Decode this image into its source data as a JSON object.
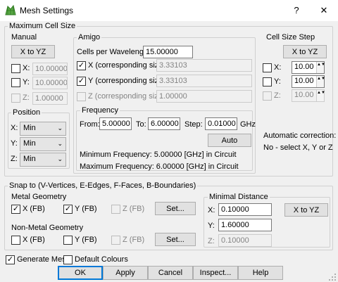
{
  "window": {
    "title": "Mesh Settings",
    "help_icon": "?",
    "close_icon": "✕"
  },
  "max_cell": {
    "group_label": "Maximum Cell Size",
    "manual": {
      "label": "Manual",
      "x_to_yz_label": "X to YZ",
      "x": {
        "label": "X:",
        "checked": false,
        "value": "10.00000",
        "disabled": true
      },
      "y": {
        "label": "Y:",
        "checked": false,
        "value": "10.00000",
        "disabled": true
      },
      "z": {
        "label": "Z:",
        "checked": false,
        "value": "1.00000",
        "disabled": true
      }
    },
    "position": {
      "label": "Position",
      "x": {
        "label": "X:",
        "value": "Min"
      },
      "y": {
        "label": "Y:",
        "value": "Min"
      },
      "z": {
        "label": "Z:",
        "value": "Min"
      }
    },
    "amigo": {
      "label": "Amigo",
      "cells_per_wavelength_label": "Cells per Wavelength:",
      "cells_per_wavelength": "15.00000",
      "x": {
        "label": "X (corresponding size)",
        "checked": true,
        "value": "3.33103"
      },
      "y": {
        "label": "Y (corresponding size)",
        "checked": true,
        "value": "3.33103"
      },
      "z": {
        "label": "Z (corresponding size)",
        "checked": false,
        "value": "1.00000"
      },
      "frequency": {
        "label": "Frequency",
        "from_label": "From:",
        "from": "5.00000",
        "to_label": "To:",
        "to": "6.00000",
        "step_label": "Step:",
        "step": "0.01000",
        "unit": "GHz",
        "auto_label": "Auto",
        "min_text": "Minimum Frequency: 5.00000 [GHz] in Circuit",
        "max_text": "Maximum Frequency: 6.00000 [GHz] in Circuit"
      }
    },
    "cell_step": {
      "label": "Cell Size Step",
      "x_to_yz_label": "X to YZ",
      "x": {
        "label": "X:",
        "checked": false,
        "value": "10.00"
      },
      "y": {
        "label": "Y:",
        "checked": false,
        "value": "10.00"
      },
      "z": {
        "label": "Z:",
        "checked": false,
        "value": "10.00",
        "disabled": true
      },
      "auto_correction_label": "Automatic correction:",
      "auto_correction_value": "No - select X, Y or Z"
    }
  },
  "snap": {
    "group_label": "Snap to (V-Vertices, E-Edges, F-Faces, B-Boundaries)",
    "metal": {
      "label": "Metal Geometry",
      "x": {
        "label": "X (FB)",
        "checked": true
      },
      "y": {
        "label": "Y (FB)",
        "checked": true
      },
      "z": {
        "label": "Z (FB)",
        "checked": false
      },
      "set_label": "Set..."
    },
    "nonmetal": {
      "label": "Non-Metal Geometry",
      "x": {
        "label": "X (FB)",
        "checked": false
      },
      "y": {
        "label": "Y (FB)",
        "checked": false
      },
      "z": {
        "label": "Z (FB)",
        "checked": false
      },
      "set_label": "Set..."
    },
    "minimal": {
      "label": "Minimal Distance",
      "x": {
        "label": "X:",
        "value": "0.10000"
      },
      "y": {
        "label": "Y:",
        "value": "1.60000"
      },
      "z": {
        "label": "Z:",
        "value": "0.10000"
      },
      "x_to_yz_label": "X to YZ"
    }
  },
  "options": {
    "generate_mesh": {
      "label": "Generate Mesh",
      "checked": true
    },
    "default_colours": {
      "label": "Default Colours",
      "checked": false
    }
  },
  "buttons": {
    "ok": "OK",
    "apply": "Apply",
    "cancel": "Cancel",
    "inspect": "Inspect...",
    "help": "Help"
  },
  "check_glyph": "✓",
  "spin_arrows": "▲▼",
  "caret": "⌄"
}
